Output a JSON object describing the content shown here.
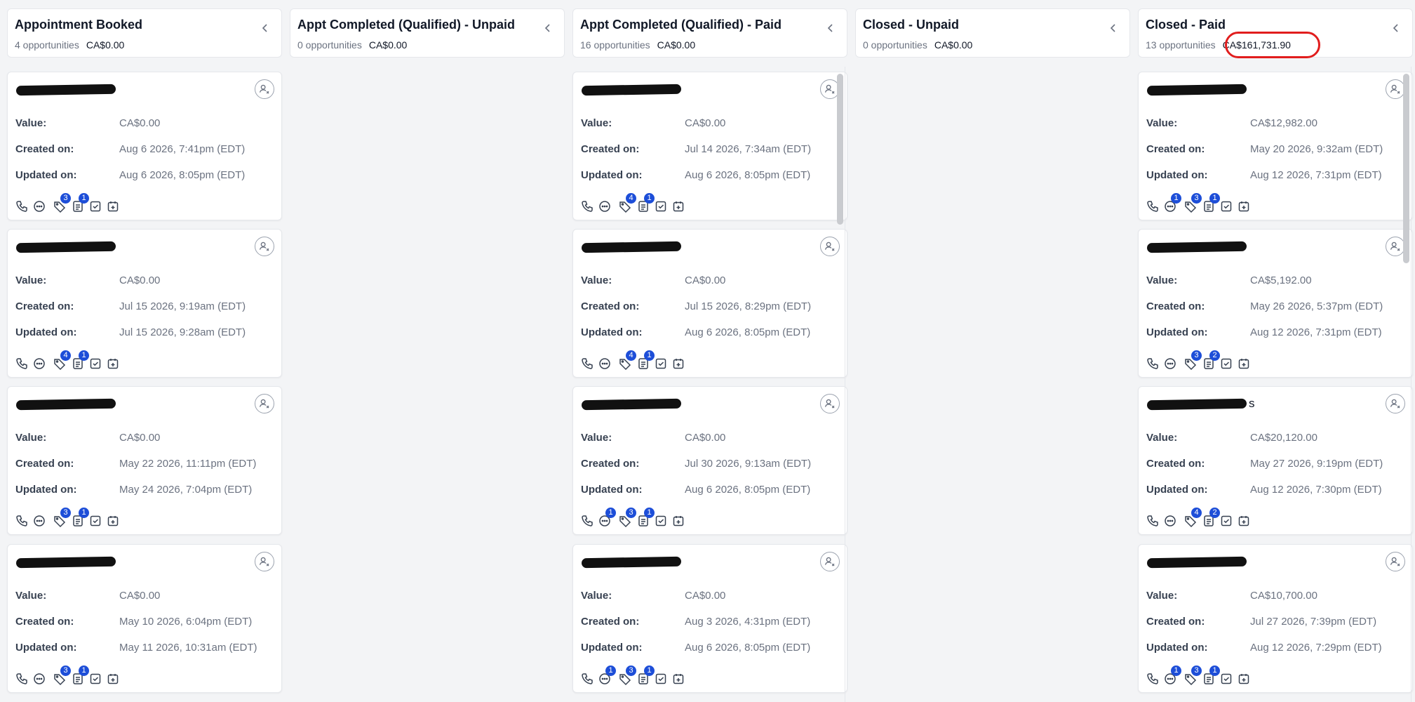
{
  "columns": [
    {
      "title": "Appointment Booked",
      "count_text": "4 opportunities",
      "amount": "CA$0.00",
      "cards": [
        {
          "value": "CA$0.00",
          "created": "Aug 6 2026, 7:41pm (EDT)",
          "updated": "Aug 6 2026, 8:05pm (EDT)",
          "badges": {
            "msg": null,
            "tag": "3",
            "note": "1"
          }
        },
        {
          "value": "CA$0.00",
          "created": "Jul 15 2026, 9:19am (EDT)",
          "updated": "Jul 15 2026, 9:28am (EDT)",
          "badges": {
            "msg": null,
            "tag": "4",
            "note": "1"
          }
        },
        {
          "value": "CA$0.00",
          "created": "May 22 2026, 11:11pm (EDT)",
          "updated": "May 24 2026, 7:04pm (EDT)",
          "badges": {
            "msg": null,
            "tag": "3",
            "note": "1"
          }
        },
        {
          "value": "CA$0.00",
          "created": "May 10 2026, 6:04pm (EDT)",
          "updated": "May 11 2026, 10:31am (EDT)",
          "badges": {
            "msg": null,
            "tag": "3",
            "note": "1"
          }
        }
      ]
    },
    {
      "title": "Appt Completed (Qualified) - Unpaid",
      "count_text": "0 opportunities",
      "amount": "CA$0.00",
      "cards": []
    },
    {
      "title": "Appt Completed (Qualified) - Paid",
      "count_text": "16 opportunities",
      "amount": "CA$0.00",
      "cards": [
        {
          "value": "CA$0.00",
          "created": "Jul 14 2026, 7:34am (EDT)",
          "updated": "Aug 6 2026, 8:05pm (EDT)",
          "badges": {
            "msg": null,
            "tag": "4",
            "note": "1"
          }
        },
        {
          "value": "CA$0.00",
          "created": "Jul 15 2026, 8:29pm (EDT)",
          "updated": "Aug 6 2026, 8:05pm (EDT)",
          "badges": {
            "msg": null,
            "tag": "4",
            "note": "1"
          }
        },
        {
          "value": "CA$0.00",
          "created": "Jul 30 2026, 9:13am (EDT)",
          "updated": "Aug 6 2026, 8:05pm (EDT)",
          "badges": {
            "msg": "1",
            "tag": "3",
            "note": "1"
          }
        },
        {
          "value": "CA$0.00",
          "created": "Aug 3 2026, 4:31pm (EDT)",
          "updated": "Aug 6 2026, 8:05pm (EDT)",
          "badges": {
            "msg": "1",
            "tag": "3",
            "note": "1"
          }
        }
      ]
    },
    {
      "title": "Closed - Unpaid",
      "count_text": "0 opportunities",
      "amount": "CA$0.00",
      "cards": []
    },
    {
      "title": "Closed - Paid",
      "count_text": "13 opportunities",
      "amount": "CA$161,731.90",
      "cards": [
        {
          "value": "CA$12,982.00",
          "created": "May 20 2026, 9:32am (EDT)",
          "updated": "Aug 12 2026, 7:31pm (EDT)",
          "badges": {
            "msg": "1",
            "tag": "3",
            "note": "1"
          }
        },
        {
          "value": "CA$5,192.00",
          "created": "May 26 2026, 5:37pm (EDT)",
          "updated": "Aug 12 2026, 7:31pm (EDT)",
          "badges": {
            "msg": null,
            "tag": "3",
            "note": "2"
          }
        },
        {
          "name_visible": "s",
          "value": "CA$20,120.00",
          "created": "May 27 2026, 9:19pm (EDT)",
          "updated": "Aug 12 2026, 7:30pm (EDT)",
          "badges": {
            "msg": null,
            "tag": "4",
            "note": "2"
          }
        },
        {
          "value": "CA$10,700.00",
          "created": "Jul 27 2026, 7:39pm (EDT)",
          "updated": "Aug 12 2026, 7:29pm (EDT)",
          "badges": {
            "msg": "1",
            "tag": "3",
            "note": "1"
          }
        }
      ]
    }
  ],
  "labels": {
    "value": "Value:",
    "created": "Created on:",
    "updated": "Updated on:"
  },
  "colors": {
    "badge": "#1d4ed8",
    "highlight_circle": "#e11d1d"
  },
  "icons": [
    "phone-icon",
    "chat-icon",
    "tag-icon",
    "note-icon",
    "task-check-icon",
    "calendar-add-icon",
    "assign-user-icon",
    "chevron-left-icon"
  ]
}
